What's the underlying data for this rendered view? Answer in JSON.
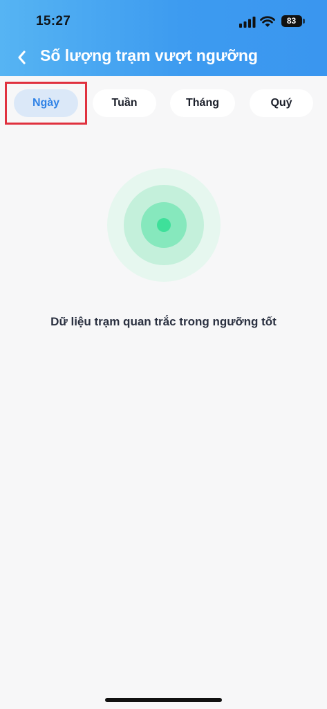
{
  "status_bar": {
    "time": "15:27",
    "battery_level": "83",
    "icons": [
      "cellular-signal-icon",
      "wifi-icon",
      "battery-icon"
    ]
  },
  "header": {
    "title": "Số lượng trạm vượt ngưỡng",
    "back_icon": "chevron-left-icon"
  },
  "tabs": [
    {
      "label": "Ngày",
      "active": true
    },
    {
      "label": "Tuần",
      "active": false
    },
    {
      "label": "Tháng",
      "active": false
    },
    {
      "label": "Quý",
      "active": false
    }
  ],
  "empty_state": {
    "icon": "radar-icon",
    "message": "Dữ liệu trạm quan trắc trong ngưỡng tốt"
  },
  "colors": {
    "header_gradient_start": "#56b4f3",
    "header_gradient_end": "#3a96ef",
    "active_tab_bg": "#dbe8f8",
    "active_tab_text": "#2f82e6",
    "highlight_border": "#e0313f",
    "radar_center": "#3ee09a"
  }
}
